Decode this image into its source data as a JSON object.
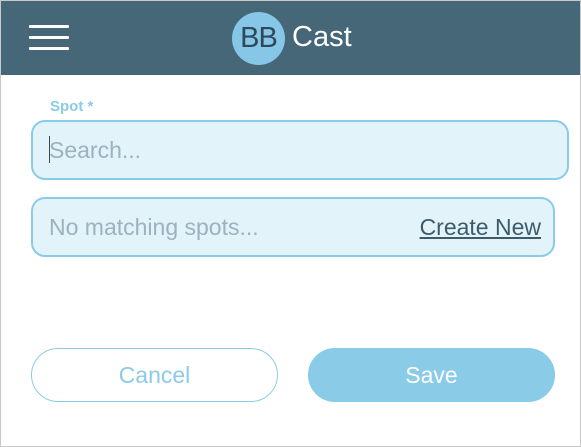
{
  "header": {
    "logo_text": "BB",
    "app_title": "Cast",
    "menu_icon": "hamburger-menu-icon"
  },
  "form": {
    "spot_label": "Spot *",
    "search_placeholder": "Search...",
    "search_value": "",
    "no_match_text": "No matching spots...",
    "create_new_label": "Create New"
  },
  "actions": {
    "cancel_label": "Cancel",
    "save_label": "Save"
  },
  "colors": {
    "header_bg": "#456778",
    "accent": "#8acbe8",
    "field_bg": "#e2f3fa",
    "link": "#3d5b6a"
  }
}
